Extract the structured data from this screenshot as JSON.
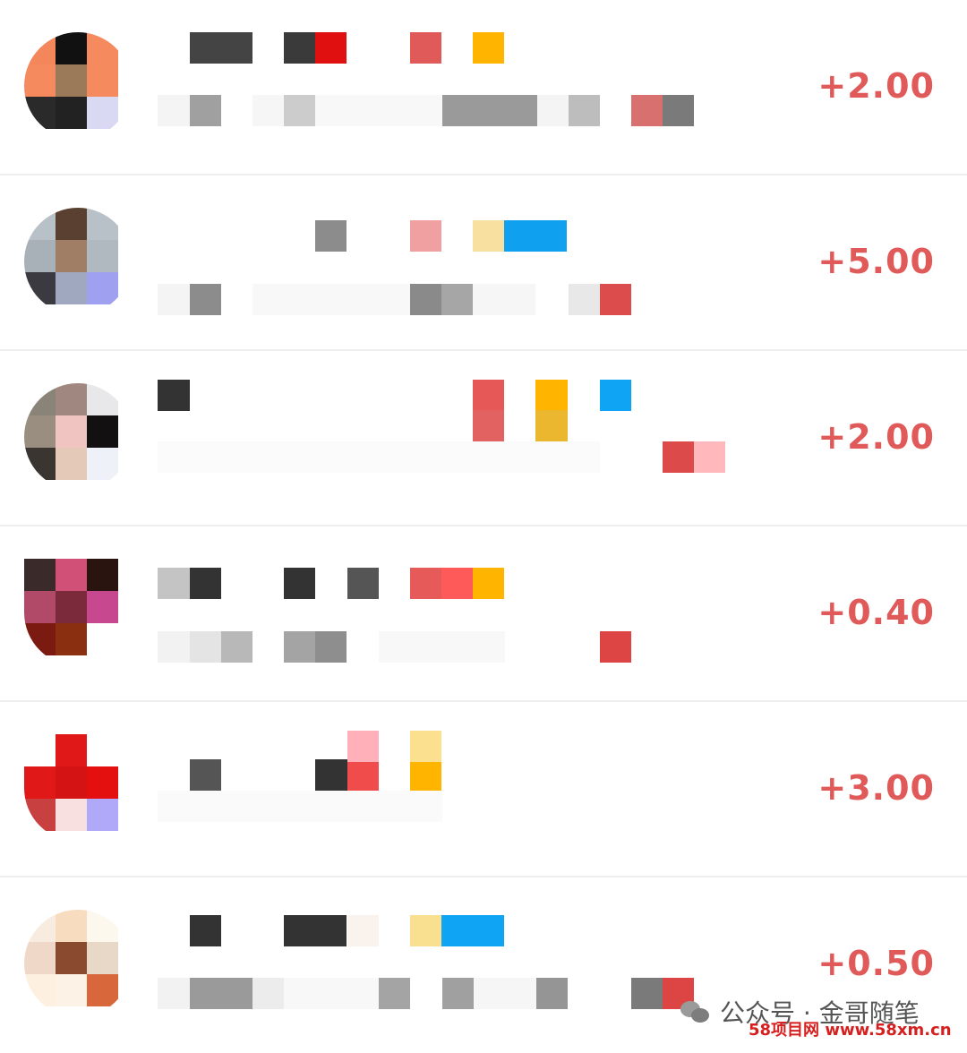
{
  "transactions": [
    {
      "amount": "+2.00"
    },
    {
      "amount": "+5.00"
    },
    {
      "amount": "+2.00"
    },
    {
      "amount": "+0.40"
    },
    {
      "amount": "+3.00"
    },
    {
      "amount": "+0.50"
    }
  ],
  "watermark": {
    "account": "公众号 · 金哥随笔",
    "site": "58项目网 www.58xm.cn"
  },
  "colors": {
    "amount": "#e05a5a",
    "divider": "#eeeeee",
    "background": "#ffffff"
  },
  "icons": {
    "watermark": "wechat-icon"
  }
}
